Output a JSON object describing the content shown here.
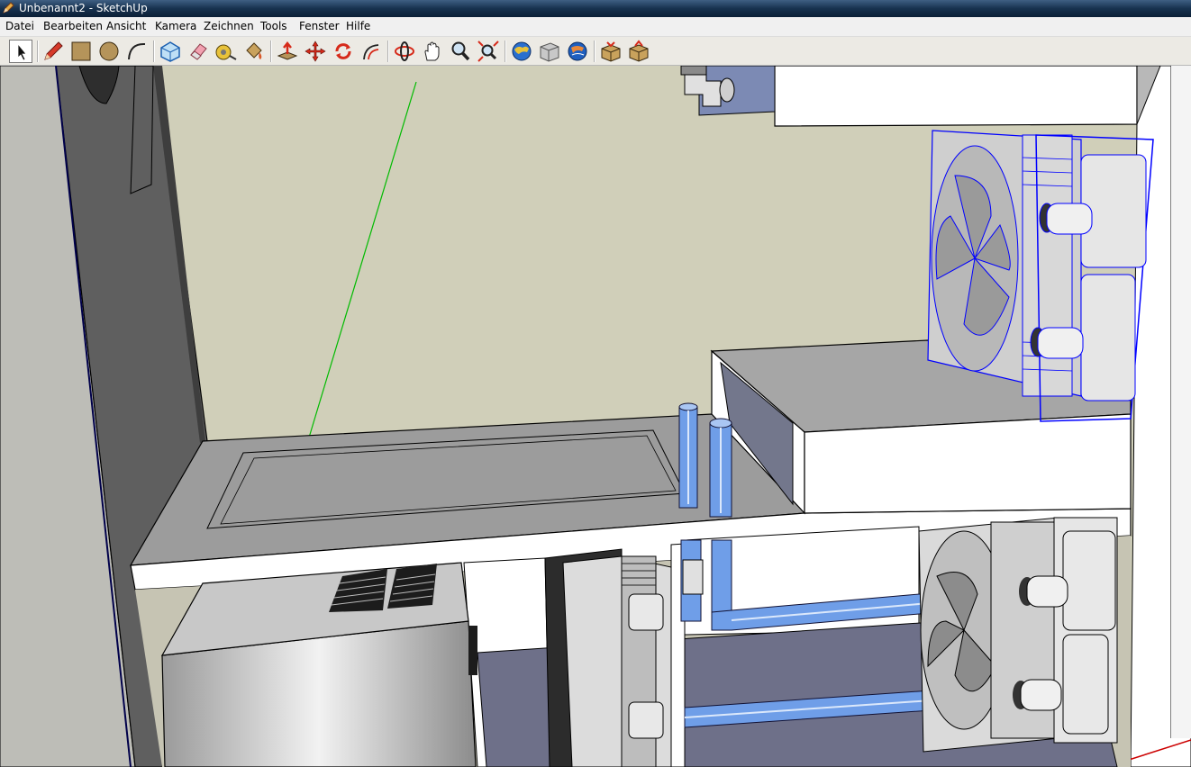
{
  "window": {
    "title": "Unbenannt2 - SketchUp",
    "app_icon": "sketchup-pencil-icon"
  },
  "menu": [
    "Datei",
    "Bearbeiten",
    "Ansicht",
    "Kamera",
    "Zeichnen",
    "Tools",
    "Fenster",
    "Hilfe"
  ],
  "toolbar": {
    "groups": [
      [
        "select-arrow-icon"
      ],
      [
        "pencil-line-icon",
        "rectangle-icon",
        "circle-icon",
        "arc-icon"
      ],
      [
        "make-component-icon",
        "eraser-icon",
        "tape-measure-icon",
        "paint-bucket-icon"
      ],
      [
        "push-pull-icon",
        "move-icon",
        "rotate-icon",
        "offset-icon"
      ],
      [
        "orbit-icon",
        "pan-hand-icon",
        "zoom-icon",
        "zoom-extents-icon"
      ],
      [
        "get-models-icon",
        "share-model-icon",
        "google-earth-icon"
      ],
      [
        "component-warehouse-icon",
        "share-component-icon"
      ]
    ],
    "active_tool": "select-arrow-icon"
  },
  "colors": {
    "titlebar": "#1a3657",
    "menubar": "#f0f0f0",
    "toolbar": "#eceae4",
    "sky": "#d0cfb9",
    "selection": "#0000ff",
    "tube": "#6f9ee8",
    "green_axis": "#00bb00",
    "red_axis": "#cc0000"
  }
}
